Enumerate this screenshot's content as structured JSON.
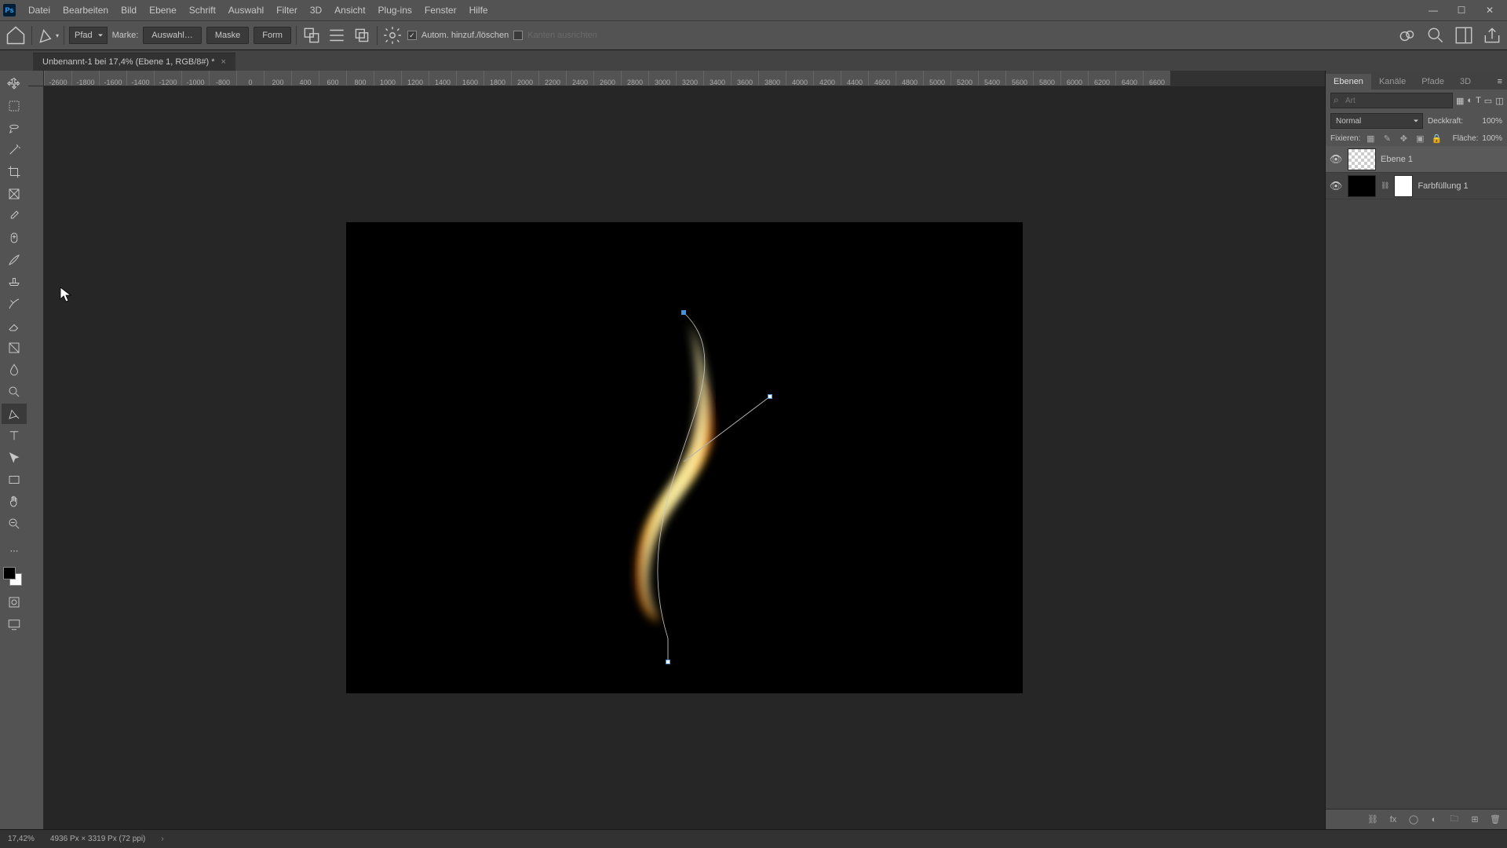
{
  "app_logo": "Ps",
  "menubar": [
    "Datei",
    "Bearbeiten",
    "Bild",
    "Ebene",
    "Schrift",
    "Auswahl",
    "Filter",
    "3D",
    "Ansicht",
    "Plug-ins",
    "Fenster",
    "Hilfe"
  ],
  "optbar": {
    "mode": "Pfad",
    "make_label": "Marke:",
    "btn_selection": "Auswahl…",
    "btn_mask": "Maske",
    "btn_shape": "Form",
    "auto_add_label": "Autom. hinzuf./löschen",
    "align_edges_label": "Kanten ausrichten"
  },
  "tab": {
    "title": "Unbenannt-1 bei 17,4% (Ebene 1, RGB/8#) *",
    "close": "×"
  },
  "ruler_ticks": [
    "-2600",
    "-1800",
    "-1600",
    "-1400",
    "-1200",
    "-1000",
    "-800",
    "0",
    "200",
    "400",
    "600",
    "800",
    "1000",
    "1200",
    "1400",
    "1600",
    "1800",
    "2000",
    "2200",
    "2400",
    "2600",
    "2800",
    "3000",
    "3200",
    "3400",
    "3600",
    "3800",
    "4000",
    "4200",
    "4400",
    "4600",
    "4800",
    "5000",
    "5200",
    "5400",
    "5600",
    "5800",
    "6000",
    "6200",
    "6400",
    "6600"
  ],
  "panels": {
    "tabs": [
      "Ebenen",
      "Kanäle",
      "Pfade",
      "3D"
    ],
    "search_placeholder": "Art",
    "blend_mode": "Normal",
    "opacity_label": "Deckkraft:",
    "opacity_value": "100%",
    "lock_label": "Fixieren:",
    "fill_label": "Fläche:",
    "fill_value": "100%",
    "layers": [
      {
        "name": "Ebene 1",
        "checker": true,
        "selected": true
      },
      {
        "name": "Farbfüllung 1",
        "checker": false,
        "has_mask": true
      }
    ]
  },
  "statusbar": {
    "zoom": "17,42%",
    "doc_info": "4936 Px × 3319 Px (72 ppi)",
    "arrow": "›"
  }
}
